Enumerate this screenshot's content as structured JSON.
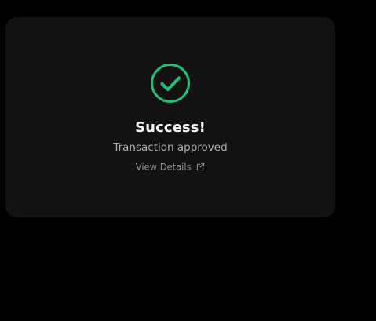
{
  "card": {
    "title": "Success!",
    "subtitle": "Transaction approved",
    "details_label": "View Details",
    "status_icon": "check-circle-icon",
    "link_icon": "external-link-icon"
  },
  "colors": {
    "background": "#000000",
    "card": "#121212",
    "success": "#22c07a",
    "title": "#f3f4f6",
    "subtitle": "#a9adb6",
    "link": "#8c9099"
  }
}
